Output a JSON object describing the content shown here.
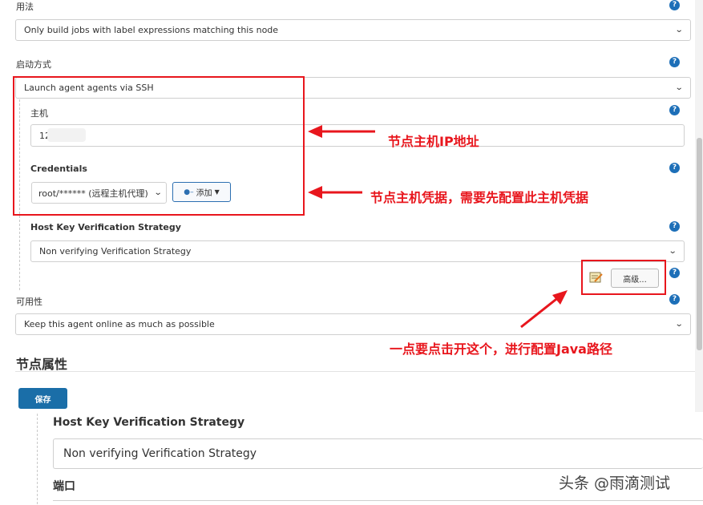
{
  "form": {
    "usage": {
      "label": "用法",
      "value": "Only build jobs with label expressions matching this node"
    },
    "launch": {
      "label": "启动方式",
      "value": "Launch agent agents via SSH"
    },
    "host": {
      "label": "主机",
      "value": "12           .52"
    },
    "credentials": {
      "label": "Credentials",
      "value": "root/****** (远程主机代理)",
      "add_label": "添加"
    },
    "host_key": {
      "label": "Host Key Verification Strategy",
      "value": "Non verifying Verification Strategy"
    },
    "advanced_label": "高级...",
    "availability": {
      "label": "可用性",
      "value": "Keep this agent online as much as possible"
    },
    "node_props_title": "节点属性",
    "save_label": "保存",
    "help_glyph": "?"
  },
  "annotations": {
    "host_ip": "节点主机IP地址",
    "credentials": "节点主机凭据，需要先配置此主机凭据",
    "advanced": "一点要点击开这个，进行配置Java路径"
  },
  "overlay": {
    "host_key_label": "Host Key Verification Strategy",
    "host_key_value": "Non verifying Verification Strategy",
    "port_label": "端口"
  },
  "watermark": "头条 @雨滴测试",
  "colors": {
    "annotation_red": "#e8161d",
    "help_blue": "#1d6fb8",
    "save_blue": "#1a6ea8"
  }
}
